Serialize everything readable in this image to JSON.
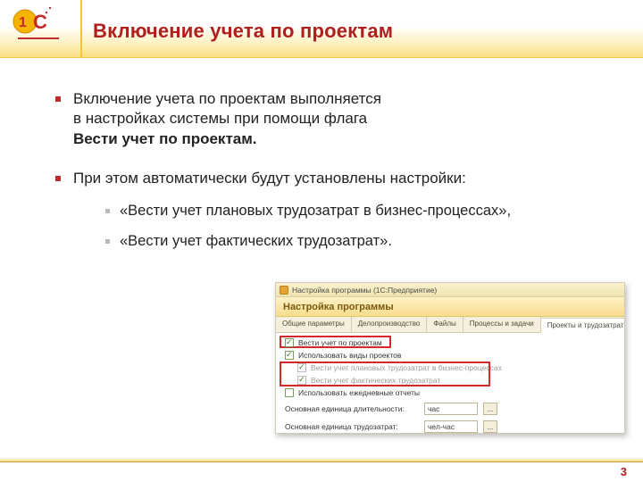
{
  "logo": {
    "brand": "1C"
  },
  "title": "Включение учета по проектам",
  "bullets": [
    {
      "lines": [
        "Включение учета по проектам выполняется",
        "в настройках системы при помощи флага"
      ],
      "bold_line": "Вести учет по проектам."
    },
    {
      "lines": [
        "При этом автоматически будут установлены настройки:"
      ],
      "sub": [
        "«Вести учет плановых трудозатрат в бизнес-процессах»,",
        "«Вести учет фактических трудозатрат»."
      ]
    }
  ],
  "screenshot": {
    "window_title": "Настройка программы  (1С:Предприятие)",
    "heading": "Настройка программы",
    "tabs": [
      "Общие параметры",
      "Делопроизводство",
      "Файлы",
      "Процессы и задачи",
      "Проекты и трудозатраты"
    ],
    "active_tab_index": 4,
    "checkboxes": [
      {
        "label": "Вести учет по проектам",
        "checked": true,
        "dim": false,
        "indent": false
      },
      {
        "label": "Использовать виды проектов",
        "checked": true,
        "dim": false,
        "indent": false
      },
      {
        "label": "Вести учет плановых трудозатрат в бизнес-процессах",
        "checked": true,
        "dim": true,
        "indent": true
      },
      {
        "label": "Вести учет фактических трудозатрат",
        "checked": true,
        "dim": true,
        "indent": true
      },
      {
        "label": "Использовать ежедневные отчеты",
        "checked": false,
        "dim": false,
        "indent": false
      }
    ],
    "fields": [
      {
        "label": "Основная единица длительности:",
        "value": "час"
      },
      {
        "label": "Основная единица трудозатрат:",
        "value": "чел-час"
      }
    ],
    "ellipsis": "..."
  },
  "page_number": "3"
}
